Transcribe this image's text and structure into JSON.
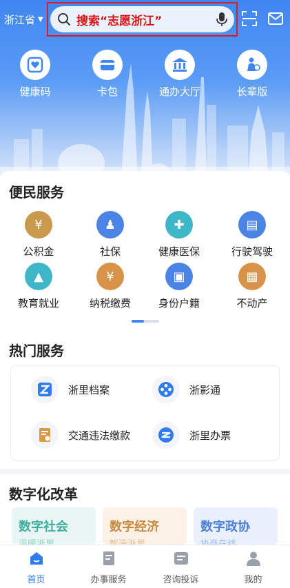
{
  "header": {
    "region": "浙江省",
    "search_text": "搜索“志愿浙江”",
    "quick_entries": [
      {
        "label": "健康码",
        "icon": "health-code-icon"
      },
      {
        "label": "卡包",
        "icon": "card-wallet-icon"
      },
      {
        "label": "通办大厅",
        "icon": "service-hall-icon"
      },
      {
        "label": "长辈版",
        "icon": "elder-mode-icon"
      }
    ]
  },
  "convenience": {
    "title": "便民服务",
    "items": [
      {
        "label": "公积金",
        "icon": "housing-fund-icon",
        "color": "#c99a4d"
      },
      {
        "label": "社保",
        "icon": "social-security-icon",
        "color": "#4c84e6"
      },
      {
        "label": "健康医保",
        "icon": "medical-insurance-icon",
        "color": "#3fb6c7"
      },
      {
        "label": "行驶驾驶",
        "icon": "driving-icon",
        "color": "#4c84e6"
      },
      {
        "label": "教育就业",
        "icon": "education-icon",
        "color": "#3fb6c7"
      },
      {
        "label": "纳税缴费",
        "icon": "tax-icon",
        "color": "#d8934a"
      },
      {
        "label": "身份户籍",
        "icon": "id-registry-icon",
        "color": "#4c84e6"
      },
      {
        "label": "不动产",
        "icon": "real-estate-icon",
        "color": "#d8934a"
      }
    ]
  },
  "hot_services": {
    "title": "热门服务",
    "items": [
      {
        "label": "浙里档案",
        "icon": "archive-icon"
      },
      {
        "label": "浙影通",
        "icon": "film-icon"
      },
      {
        "label": "交通违法缴款",
        "icon": "traffic-fine-icon"
      },
      {
        "label": "浙里办票",
        "icon": "invoice-icon"
      }
    ]
  },
  "reform": {
    "title": "数字化改革",
    "cards": [
      {
        "title": "数字社会",
        "subtitle": "温暖浙里",
        "color": "#3fae9e",
        "bg": "#eaf6f3"
      },
      {
        "title": "数字经济",
        "subtitle": "智造浙里",
        "color": "#c98a3f",
        "bg": "#fbf1e6"
      },
      {
        "title": "数字政协",
        "subtitle": "协商在线",
        "color": "#4a7fd8",
        "bg": "#eaf1fc"
      }
    ]
  },
  "tabbar": {
    "tabs": [
      {
        "label": "首页",
        "active": true
      },
      {
        "label": "办事服务",
        "active": false
      },
      {
        "label": "咨询投诉",
        "active": false
      },
      {
        "label": "我的",
        "active": false
      }
    ]
  },
  "colors": {
    "brand_blue": "#3f86f2",
    "highlight_red": "#d81818"
  }
}
